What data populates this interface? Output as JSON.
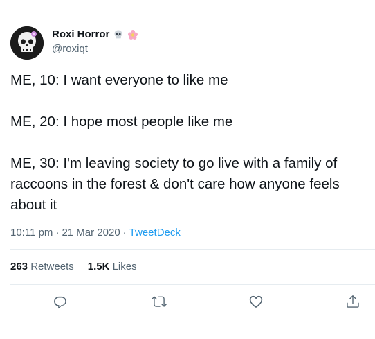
{
  "author": {
    "display_name": "Roxi Horror",
    "handle": "@roxiqt",
    "name_emojis": [
      "skull-emoji",
      "flower-emoji"
    ]
  },
  "tweet": {
    "lines": [
      "ME, 10: I want everyone to like me",
      "ME, 20: I hope most people like me",
      "ME, 30: I'm leaving society to go live with a family of raccoons in the forest & don't care how anyone feels about it"
    ],
    "time": "10:11 pm",
    "date": "21 Mar 2020",
    "separator": "·",
    "source": "TweetDeck"
  },
  "stats": {
    "retweets_count": "263",
    "retweets_label": "Retweets",
    "likes_count": "1.5K",
    "likes_label": "Likes"
  },
  "actions": [
    "reply-icon",
    "retweet-icon",
    "like-icon",
    "share-icon"
  ],
  "colors": {
    "text": "#0f1419",
    "secondary": "#536471",
    "link": "#1d9bf0",
    "divider": "#e6ecf0"
  }
}
